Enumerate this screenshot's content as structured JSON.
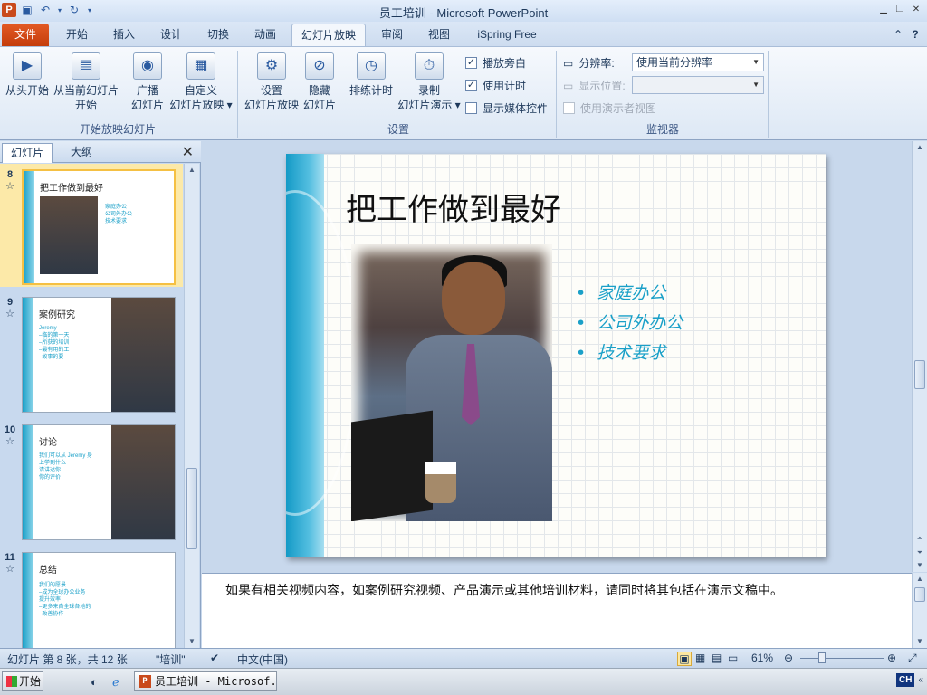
{
  "window": {
    "title": "员工培训 - Microsoft PowerPoint",
    "app_icon": "P"
  },
  "tabs": [
    "文件",
    "开始",
    "插入",
    "设计",
    "切换",
    "动画",
    "幻灯片放映",
    "审阅",
    "视图",
    "iSpring Free"
  ],
  "ribbon": {
    "start_group": {
      "label": "开始放映幻灯片",
      "from_beginning": "从头开始",
      "from_current_1": "从当前幻灯片",
      "from_current_2": "开始",
      "broadcast_1": "广播",
      "broadcast_2": "幻灯片",
      "custom_1": "自定义",
      "custom_2": "幻灯片放映 ▾"
    },
    "setup_group": {
      "label": "设置",
      "setup_1": "设置",
      "setup_2": "幻灯片放映",
      "hide_1": "隐藏",
      "hide_2": "幻灯片",
      "rehearse": "排练计时",
      "record_1": "录制",
      "record_2": "幻灯片演示 ▾",
      "play_narrations": "播放旁白",
      "use_timings": "使用计时",
      "show_media_controls": "显示媒体控件"
    },
    "monitor_group": {
      "label": "监视器",
      "resolution_label": "分辨率:",
      "resolution_value": "使用当前分辨率",
      "show_on_label": "显示位置:",
      "presenter_view": "使用演示者视图"
    }
  },
  "panel": {
    "tab_slides": "幻灯片",
    "tab_outline": "大纲"
  },
  "thumbnails": [
    {
      "num": "8",
      "title": "把工作做到最好",
      "bullets": [
        "家庭办公",
        "公司外办公",
        "技术要求"
      ]
    },
    {
      "num": "9",
      "title": "案例研究",
      "bullets": [
        "Jeremy",
        "  –临的第一天",
        "  –所获的培训",
        "  –最有用的工",
        "  –故事的要"
      ]
    },
    {
      "num": "10",
      "title": "讨论",
      "bullets": [
        "我们可以从 Jeremy 身",
        "  上学到什么",
        "请讲述你",
        "你的评价"
      ]
    },
    {
      "num": "11",
      "title": "总结",
      "bullets": [
        "我们的愿景",
        "  –成为全球办公业务",
        "提升效率",
        "  –更多来自全球各地的",
        "  –改善协作"
      ]
    }
  ],
  "slide": {
    "title": "把工作做到最好",
    "bullets": [
      "家庭办公",
      "公司外办公",
      "技术要求"
    ]
  },
  "notes": "如果有相关视频内容，如案例研究视频、产品演示或其他培训材料，请同时将其包括在演示文稿中。",
  "status": {
    "slide_info": "幻灯片 第 8 张，共 12 张",
    "theme": "\"培训\"",
    "language": "中文(中国)",
    "zoom": "61%"
  },
  "taskbar": {
    "start": "开始",
    "task": "员工培训 - Microsof...",
    "ime": "CH"
  }
}
